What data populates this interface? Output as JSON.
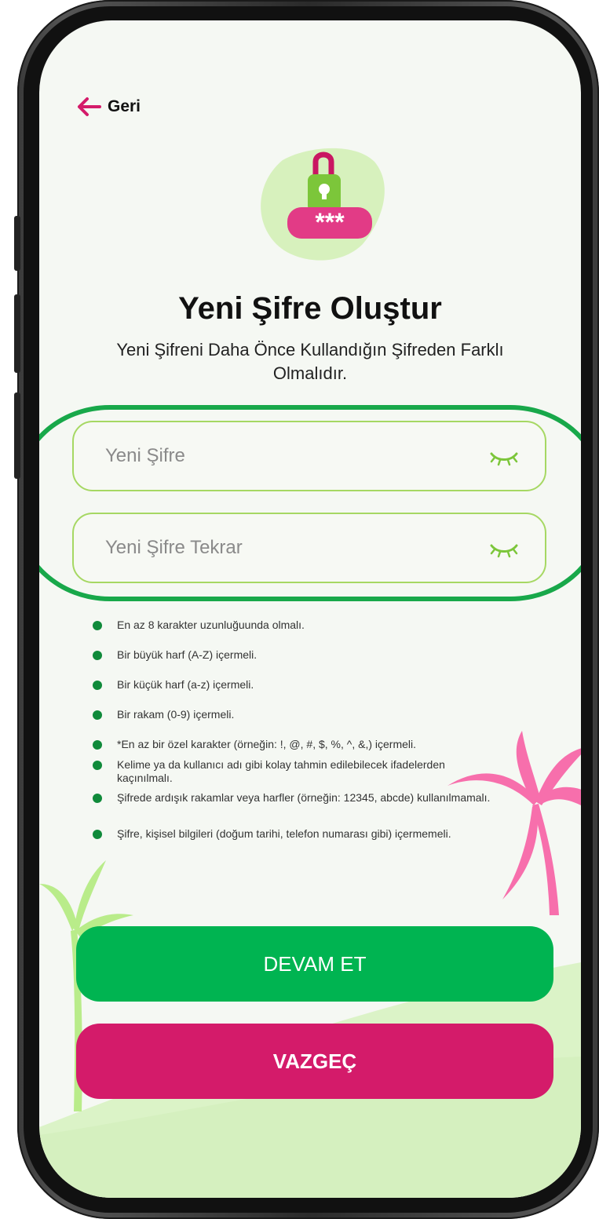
{
  "header": {
    "back_label": "Geri"
  },
  "main": {
    "title": "Yeni Şifre Oluştur",
    "subtitle": "Yeni Şifreni Daha Önce Kullandığın Şifreden Farklı Olmalıdır.",
    "new_password_placeholder": "Yeni Şifre",
    "confirm_password_placeholder": "Yeni Şifre Tekrar",
    "lock_text": "***"
  },
  "rules": [
    "En az 8 karakter uzunluğuunda olmalı.",
    "Bir büyük harf (A-Z) içermeli.",
    "Bir küçük harf (a-z) içermeli.",
    "Bir rakam (0-9) içermeli.",
    "*En az bir özel karakter (örneğin: !, @, #, $, %, ^, &,) içermeli.",
    "Kelime ya da kullanıcı adı gibi kolay tahmin edilebilecek ifadelerden kaçınılmalı.",
    "Şifrede ardışık rakamlar veya harfler (örneğin: 12345, abcde) kullanılmamalı.",
    "Şifre, kişisel bilgileri (doğum tarihi, telefon numarası gibi) içermemeli."
  ],
  "buttons": {
    "continue_label": "DEVAM ET",
    "cancel_label": "VAZGEÇ"
  },
  "colors": {
    "primary_green": "#00b451",
    "cancel_pink": "#d41b6a",
    "field_border": "#a6d863",
    "highlight_ring": "#18a84a",
    "palm_pink": "#f76fac",
    "palm_green": "#b9ec8a"
  },
  "icons": {
    "back": "arrow-left-icon",
    "eye": "eye-closed-icon",
    "lock": "lock-password-icon"
  }
}
